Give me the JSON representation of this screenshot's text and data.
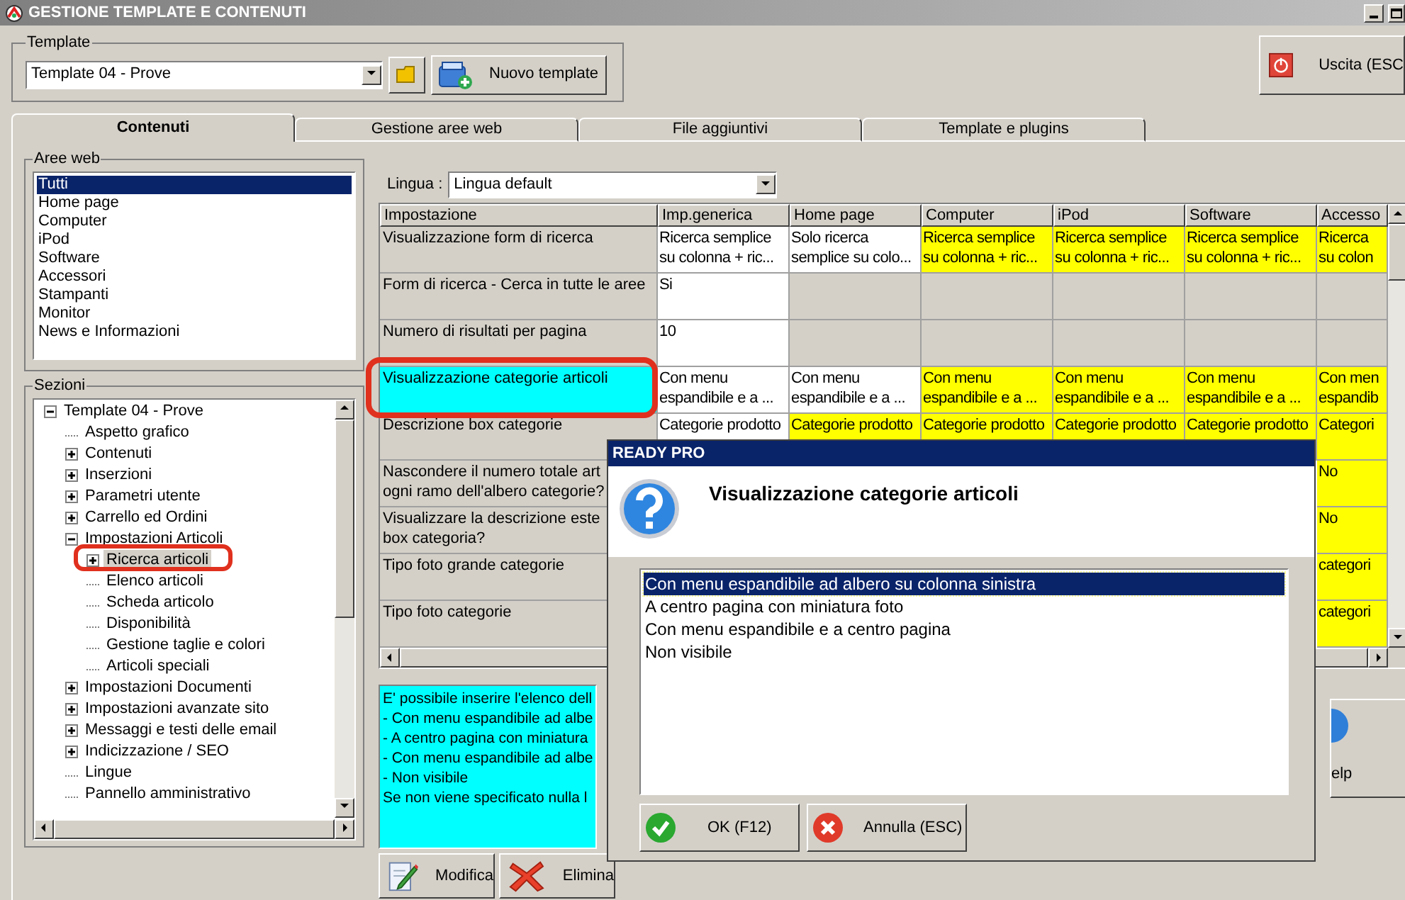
{
  "window": {
    "title": "GESTIONE TEMPLATE E CONTENUTI"
  },
  "template_group": {
    "label": "Template",
    "value": "Template 04 - Prove",
    "new_button": "Nuovo template"
  },
  "exit_button": "Uscita (ESC",
  "tabs": [
    {
      "label": "Contenuti",
      "selected": true
    },
    {
      "label": "Gestione aree web",
      "selected": false
    },
    {
      "label": "File aggiuntivi",
      "selected": false
    },
    {
      "label": "Template e plugins",
      "selected": false
    }
  ],
  "web_areas": {
    "label": "Aree web",
    "items": [
      {
        "label": "Tutti",
        "selected": true
      },
      {
        "label": "Home page",
        "selected": false
      },
      {
        "label": "Computer",
        "selected": false
      },
      {
        "label": "iPod",
        "selected": false
      },
      {
        "label": "Software",
        "selected": false
      },
      {
        "label": "Accessori",
        "selected": false
      },
      {
        "label": "Stampanti",
        "selected": false
      },
      {
        "label": "Monitor",
        "selected": false
      },
      {
        "label": "News e Informazioni",
        "selected": false
      }
    ]
  },
  "sections": {
    "label": "Sezioni",
    "tree": [
      {
        "label": "Template 04 - Prove",
        "kind": "folder",
        "expanded": true,
        "selected": false,
        "children": [
          {
            "label": "Aspetto grafico",
            "kind": "leaf",
            "selected": false
          },
          {
            "label": "Contenuti",
            "kind": "folder",
            "expanded": false,
            "selected": false
          },
          {
            "label": "Inserzioni",
            "kind": "folder",
            "expanded": false,
            "selected": false
          },
          {
            "label": "Parametri utente",
            "kind": "folder",
            "expanded": false,
            "selected": false
          },
          {
            "label": "Carrello ed Ordini",
            "kind": "folder",
            "expanded": false,
            "selected": false
          },
          {
            "label": "Impostazioni Articoli",
            "kind": "folder",
            "expanded": true,
            "selected": false,
            "children": [
              {
                "label": "Ricerca articoli",
                "kind": "folder",
                "expanded": false,
                "selected": true
              },
              {
                "label": "Elenco articoli",
                "kind": "leaf",
                "selected": false
              },
              {
                "label": "Scheda articolo",
                "kind": "leaf",
                "selected": false
              },
              {
                "label": "Disponibilità",
                "kind": "leaf",
                "selected": false
              },
              {
                "label": "Gestione taglie e colori",
                "kind": "leaf",
                "selected": false
              },
              {
                "label": "Articoli speciali",
                "kind": "leaf",
                "selected": false
              }
            ]
          },
          {
            "label": "Impostazioni Documenti",
            "kind": "folder",
            "expanded": false,
            "selected": false
          },
          {
            "label": "Impostazioni avanzate sito",
            "kind": "folder",
            "expanded": false,
            "selected": false
          },
          {
            "label": "Messaggi e testi delle email",
            "kind": "folder",
            "expanded": false,
            "selected": false
          },
          {
            "label": "Indicizzazione / SEO",
            "kind": "folder",
            "expanded": false,
            "selected": false
          },
          {
            "label": "Lingue",
            "kind": "leaf",
            "selected": false
          },
          {
            "label": "Pannello amministrativo",
            "kind": "leaf",
            "selected": false
          }
        ]
      }
    ]
  },
  "language": {
    "label": "Lingua :",
    "value": "Lingua default"
  },
  "grid": {
    "setting_header": "Impostazione",
    "columns": [
      "Imp.generica",
      "Home page",
      "Computer",
      "iPod",
      "Software",
      "Accesso"
    ],
    "rows": [
      {
        "setting": [
          "Visualizzazione form di ricerca"
        ],
        "selected": false,
        "cells": [
          {
            "lines": [
              "Ricerca semplice",
              "su colonna + ric..."
            ],
            "kind": "value"
          },
          {
            "lines": [
              "Solo ricerca",
              "semplice su colo..."
            ],
            "kind": "value"
          },
          {
            "lines": [
              "Ricerca semplice",
              "su colonna + ric..."
            ],
            "kind": "area"
          },
          {
            "lines": [
              "Ricerca semplice",
              "su colonna + ric..."
            ],
            "kind": "area"
          },
          {
            "lines": [
              "Ricerca semplice",
              "su colonna + ric..."
            ],
            "kind": "area"
          },
          {
            "lines": [
              "Ricerca",
              "su colon"
            ],
            "kind": "area"
          }
        ]
      },
      {
        "setting": [
          "Form di ricerca - Cerca in tutte le aree"
        ],
        "selected": false,
        "cells": [
          {
            "lines": [
              "Si"
            ],
            "kind": "value"
          },
          {
            "kind": "empty"
          },
          {
            "kind": "empty"
          },
          {
            "kind": "empty"
          },
          {
            "kind": "empty"
          },
          {
            "kind": "empty"
          }
        ]
      },
      {
        "setting": [
          "Numero di risultati per pagina"
        ],
        "selected": false,
        "cells": [
          {
            "lines": [
              "10"
            ],
            "kind": "value"
          },
          {
            "kind": "empty"
          },
          {
            "kind": "empty"
          },
          {
            "kind": "empty"
          },
          {
            "kind": "empty"
          },
          {
            "kind": "empty"
          }
        ]
      },
      {
        "setting": [
          "Visualizzazione categorie articoli"
        ],
        "selected": true,
        "cells": [
          {
            "lines": [
              "Con menu",
              "espandibile e a ..."
            ],
            "kind": "value"
          },
          {
            "lines": [
              "Con menu",
              "espandibile e a ..."
            ],
            "kind": "value"
          },
          {
            "lines": [
              "Con menu",
              "espandibile e a ..."
            ],
            "kind": "area"
          },
          {
            "lines": [
              "Con menu",
              "espandibile e a ..."
            ],
            "kind": "area"
          },
          {
            "lines": [
              "Con menu",
              "espandibile e a ..."
            ],
            "kind": "area"
          },
          {
            "lines": [
              "Con men",
              "espandib"
            ],
            "kind": "area"
          }
        ]
      },
      {
        "setting": [
          "Descrizione box categorie"
        ],
        "selected": false,
        "cells": [
          {
            "lines": [
              "Categorie prodotto"
            ],
            "kind": "value"
          },
          {
            "lines": [
              "Categorie prodotto"
            ],
            "kind": "area"
          },
          {
            "lines": [
              "Categorie prodotto"
            ],
            "kind": "area"
          },
          {
            "lines": [
              "Categorie prodotto"
            ],
            "kind": "area"
          },
          {
            "lines": [
              "Categorie prodotto"
            ],
            "kind": "area"
          },
          {
            "lines": [
              "Categori"
            ],
            "kind": "area"
          }
        ]
      },
      {
        "setting": [
          "Nascondere il numero totale art",
          "ogni ramo dell'albero categorie?"
        ],
        "selected": false,
        "cells": [
          {
            "lines": [
              "No"
            ],
            "kind": "area"
          }
        ]
      },
      {
        "setting": [
          "Visualizzare la descrizione este",
          "box categoria?"
        ],
        "selected": false,
        "cells": [
          {
            "lines": [
              "No"
            ],
            "kind": "area"
          }
        ]
      },
      {
        "setting": [
          "Tipo foto grande categorie"
        ],
        "selected": false,
        "cells": [
          {
            "lines": [
              "categori"
            ],
            "kind": "area"
          }
        ]
      },
      {
        "setting": [
          "Tipo foto categorie"
        ],
        "selected": false,
        "cells": [
          {
            "lines": [
              "categori"
            ],
            "kind": "area"
          }
        ]
      }
    ]
  },
  "description": {
    "lines": [
      "E' possibile inserire l'elenco dell",
      "- Con menu espandibile ad albe",
      "- A centro pagina con miniatura",
      "- Con menu espandibile ad albe",
      "- Non visibile",
      "Se non viene specificato nulla l"
    ]
  },
  "actions": [
    {
      "label": "Modifica",
      "kind": "edit"
    },
    {
      "label": "Elimina",
      "kind": "delete"
    }
  ],
  "help_button": "elp",
  "dialog": {
    "title": "READY PRO",
    "heading": "Visualizzazione categorie articoli",
    "options": [
      {
        "label": "Con menu espandibile ad albero su colonna sinistra",
        "selected": true
      },
      {
        "label": "A centro pagina con miniatura foto",
        "selected": false
      },
      {
        "label": "Con menu espandibile e a centro pagina",
        "selected": false
      },
      {
        "label": "Non visibile",
        "selected": false
      }
    ],
    "ok": "OK (F12)",
    "cancel": "Annulla (ESC)"
  }
}
